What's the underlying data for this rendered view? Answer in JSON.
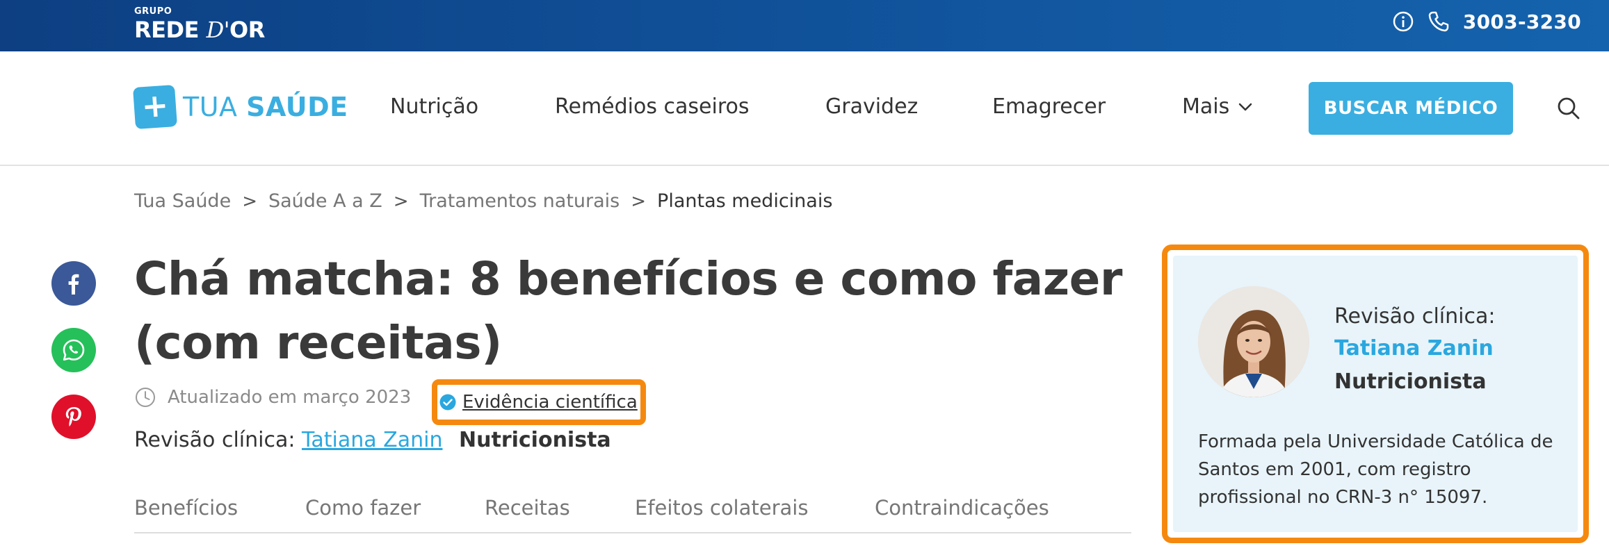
{
  "topbar": {
    "brand_small": "GRUPO",
    "brand_main_prefix": "REDE ",
    "brand_main_script": "D'",
    "brand_main_suffix": "OR",
    "phone": "3003-3230",
    "icons": [
      "info-icon",
      "phone-icon"
    ]
  },
  "nav": {
    "logo_plus": "+",
    "logo_light": "TUA ",
    "logo_bold": "SAÚDE",
    "items": [
      "Nutrição",
      "Remédios caseiros",
      "Gravidez",
      "Emagrecer"
    ],
    "more_label": "Mais",
    "cta_label": "BUSCAR MÉDICO",
    "accent_color": "#3aaee0"
  },
  "breadcrumb": {
    "items": [
      "Tua Saúde",
      "Saúde A a Z",
      "Tratamentos naturais"
    ],
    "current": "Plantas medicinais",
    "separator": ">"
  },
  "share": {
    "icons": [
      "facebook-icon",
      "whatsapp-icon",
      "pinterest-icon"
    ]
  },
  "article": {
    "title_line1": "Chá matcha: 8 benefícios e como fazer",
    "title_line2": "(com receitas)",
    "updated": "Atualizado em março 2023",
    "evidence_label": "Evidência científica",
    "review_prefix": "Revisão clínica:",
    "reviewer_name": "Tatiana Zanin",
    "reviewer_profession": "Nutricionista",
    "highlight_color": "#f5890f"
  },
  "tabs": [
    "Benefícios",
    "Como fazer",
    "Receitas",
    "Efeitos colaterais",
    "Contraindicações"
  ],
  "reviewer_card": {
    "label": "Revisão clínica:",
    "name": "Tatiana Zanin",
    "profession": "Nutricionista",
    "bio": "Formada pela Universidade Católica de Santos em 2001, com registro profissional no CRN-3 n° 15097."
  }
}
